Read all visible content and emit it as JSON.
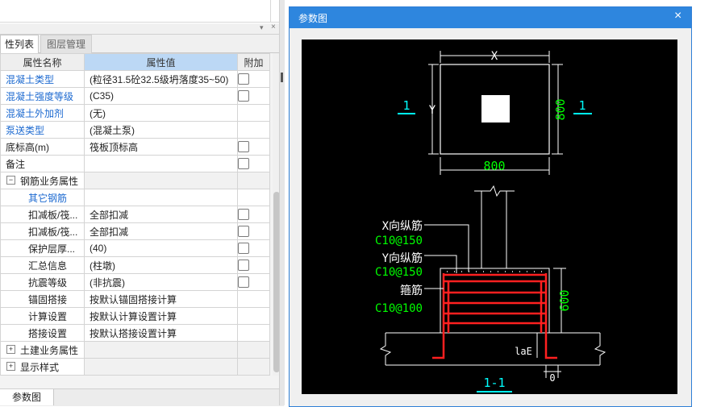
{
  "left_panel": {
    "tabs": {
      "active": "性列表",
      "inactive": "图层管理"
    },
    "columns": {
      "name": "属性名称",
      "value": "属性值",
      "extra": "附加"
    },
    "rows": [
      {
        "name": "混凝土类型",
        "value": "(粒径31.5砼32.5级坍落度35~50)",
        "style": "blue",
        "check": true
      },
      {
        "name": "混凝土强度等级",
        "value": "(C35)",
        "style": "blue",
        "check": true
      },
      {
        "name": "混凝土外加剂",
        "value": "(无)",
        "style": "blue",
        "check": false
      },
      {
        "name": "泵送类型",
        "value": "(混凝土泵)",
        "style": "blue",
        "check": false
      },
      {
        "name": "底标高(m)",
        "value": "筏板顶标高",
        "style": "normal",
        "check": true
      },
      {
        "name": "备注",
        "value": "",
        "style": "normal",
        "check": true
      },
      {
        "name": "钢筋业务属性",
        "value": "",
        "style": "group",
        "expander": "−",
        "check": false
      },
      {
        "name": "其它钢筋",
        "value": "",
        "style": "subblue",
        "check": false
      },
      {
        "name": "扣减板/筏...",
        "value": "全部扣减",
        "style": "sub",
        "check": true
      },
      {
        "name": "扣减板/筏...",
        "value": "全部扣减",
        "style": "sub",
        "check": true
      },
      {
        "name": "保护层厚...",
        "value": "(40)",
        "style": "sub",
        "check": true
      },
      {
        "name": "汇总信息",
        "value": "(柱墩)",
        "style": "sub",
        "check": true
      },
      {
        "name": "抗震等级",
        "value": "(非抗震)",
        "style": "sub",
        "check": true
      },
      {
        "name": "锚固搭接",
        "value": "按默认锚固搭接计算",
        "style": "sub",
        "check": false
      },
      {
        "name": "计算设置",
        "value": "按默认计算设置计算",
        "style": "sub",
        "check": false
      },
      {
        "name": "搭接设置",
        "value": "按默认搭接设置计算",
        "style": "sub",
        "check": false
      },
      {
        "name": "土建业务属性",
        "value": "",
        "style": "group",
        "expander": "+",
        "check": false
      },
      {
        "name": "显示样式",
        "value": "",
        "style": "group",
        "expander": "+",
        "check": false
      }
    ],
    "bottom_tab": "参数图"
  },
  "dialog": {
    "title": "参数图",
    "close": "×",
    "drawing": {
      "plan": {
        "x_label": "X",
        "y_label": "Y",
        "bottom_dim": "800",
        "right_dim": "800",
        "section_mark": "1"
      },
      "section": {
        "x_bar_label": "X向纵筋",
        "x_bar_spec": "C10@150",
        "y_bar_label": "Y向纵筋",
        "y_bar_spec": "C10@150",
        "stirrup_label": "箍筋",
        "stirrup_spec": "C10@100",
        "height_dim": "600",
        "anchor_label": "laE",
        "zero_dim": "0",
        "section_title": "1-1"
      }
    }
  }
}
